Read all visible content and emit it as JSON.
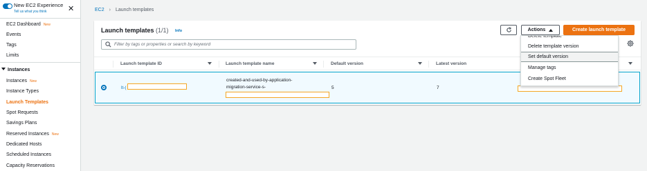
{
  "sidebar": {
    "experience_title": "New EC2 Experience",
    "experience_sub": "Tell us what you think",
    "items": [
      {
        "label": "EC2 Dashboard",
        "badge": "New"
      },
      {
        "label": "Events"
      },
      {
        "label": "Tags"
      },
      {
        "label": "Limits"
      }
    ],
    "instances_section": "Instances",
    "instance_items": [
      {
        "label": "Instances",
        "badge": "New"
      },
      {
        "label": "Instance Types"
      },
      {
        "label": "Launch Templates",
        "active": true
      },
      {
        "label": "Spot Requests"
      },
      {
        "label": "Savings Plans"
      },
      {
        "label": "Reserved Instances",
        "badge": "New"
      },
      {
        "label": "Dedicated Hosts"
      },
      {
        "label": "Scheduled Instances"
      },
      {
        "label": "Capacity Reservations"
      }
    ]
  },
  "breadcrumb": {
    "root": "EC2",
    "current": "Launch templates"
  },
  "panel": {
    "title": "Launch templates",
    "count": "(1/1)",
    "info": "Info",
    "actions_label": "Actions",
    "create_label": "Create launch template",
    "search_placeholder": "Filter by tags or properties or search by keyword"
  },
  "table": {
    "columns": [
      "Launch template ID",
      "Launch template name",
      "Default version",
      "Latest version"
    ],
    "rows": [
      {
        "id": "lt-(",
        "name_line1": "created-and-used-by-application-",
        "name_line2": "migration-service-s-",
        "default_version": "5",
        "latest_version": "7"
      }
    ]
  },
  "actions_menu": {
    "items": [
      "Delete template",
      "Delete template version",
      "Set default version",
      "Manage tags",
      "Create Spot Fleet"
    ],
    "highlighted": "Set default version"
  },
  "colors": {
    "accent": "#ec7211",
    "link": "#0073bb"
  }
}
